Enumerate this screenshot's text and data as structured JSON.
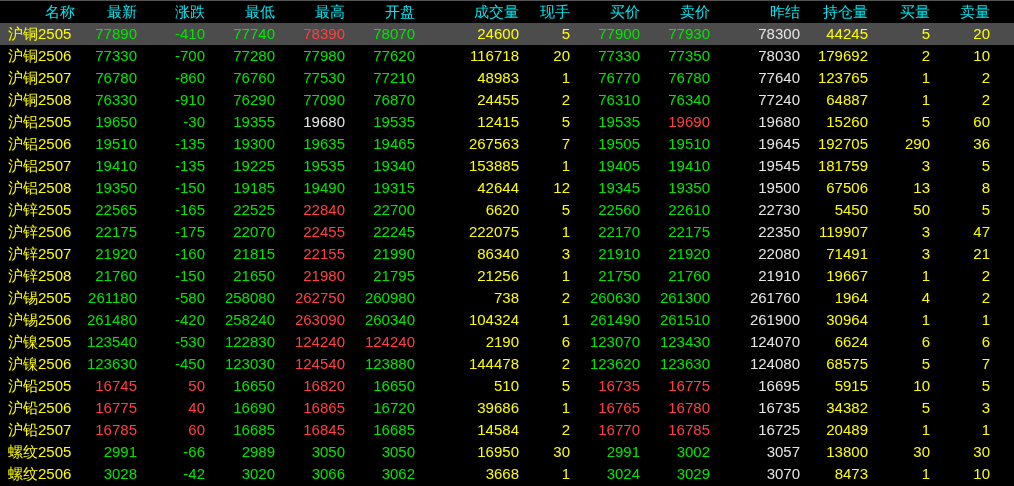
{
  "table": {
    "columns": [
      {
        "label": "名称",
        "kind": "name"
      },
      {
        "label": "最新",
        "kind": "price"
      },
      {
        "label": "涨跌",
        "kind": "change"
      },
      {
        "label": "最低",
        "kind": "price"
      },
      {
        "label": "最高",
        "kind": "price"
      },
      {
        "label": "开盘",
        "kind": "price"
      },
      {
        "label": "成交量",
        "kind": "volume"
      },
      {
        "label": "现手",
        "kind": "volume"
      },
      {
        "label": "买价",
        "kind": "price"
      },
      {
        "label": "卖价",
        "kind": "price"
      },
      {
        "label": "昨结",
        "kind": "settle"
      },
      {
        "label": "持仓量",
        "kind": "volume"
      },
      {
        "label": "买量",
        "kind": "volume"
      },
      {
        "label": "卖量",
        "kind": "volume"
      }
    ],
    "rows": [
      {
        "selected": true,
        "cells": [
          "沪铜2505",
          "77890",
          "-410",
          "77740",
          "78390",
          "78070",
          "24600",
          "5",
          "77900",
          "77930",
          "78300",
          "44245",
          "5",
          "20"
        ]
      },
      {
        "selected": false,
        "cells": [
          "沪铜2506",
          "77330",
          "-700",
          "77280",
          "77980",
          "77620",
          "116718",
          "20",
          "77330",
          "77350",
          "78030",
          "179692",
          "2",
          "10"
        ]
      },
      {
        "selected": false,
        "cells": [
          "沪铜2507",
          "76780",
          "-860",
          "76760",
          "77530",
          "77210",
          "48983",
          "1",
          "76770",
          "76780",
          "77640",
          "123765",
          "1",
          "2"
        ]
      },
      {
        "selected": false,
        "cells": [
          "沪铜2508",
          "76330",
          "-910",
          "76290",
          "77090",
          "76870",
          "24455",
          "2",
          "76310",
          "76340",
          "77240",
          "64887",
          "1",
          "2"
        ]
      },
      {
        "selected": false,
        "cells": [
          "沪铝2505",
          "19650",
          "-30",
          "19355",
          "19680",
          "19535",
          "12415",
          "5",
          "19535",
          "19690",
          "19680",
          "15260",
          "5",
          "60"
        ]
      },
      {
        "selected": false,
        "cells": [
          "沪铝2506",
          "19510",
          "-135",
          "19300",
          "19635",
          "19465",
          "267563",
          "7",
          "19505",
          "19510",
          "19645",
          "192705",
          "290",
          "36"
        ]
      },
      {
        "selected": false,
        "cells": [
          "沪铝2507",
          "19410",
          "-135",
          "19225",
          "19535",
          "19340",
          "153885",
          "1",
          "19405",
          "19410",
          "19545",
          "181759",
          "3",
          "5"
        ]
      },
      {
        "selected": false,
        "cells": [
          "沪铝2508",
          "19350",
          "-150",
          "19185",
          "19490",
          "19315",
          "42644",
          "12",
          "19345",
          "19350",
          "19500",
          "67506",
          "13",
          "8"
        ]
      },
      {
        "selected": false,
        "cells": [
          "沪锌2505",
          "22565",
          "-165",
          "22525",
          "22840",
          "22700",
          "6620",
          "5",
          "22560",
          "22610",
          "22730",
          "5450",
          "50",
          "5"
        ]
      },
      {
        "selected": false,
        "cells": [
          "沪锌2506",
          "22175",
          "-175",
          "22070",
          "22455",
          "22245",
          "222075",
          "1",
          "22170",
          "22175",
          "22350",
          "119907",
          "3",
          "47"
        ]
      },
      {
        "selected": false,
        "cells": [
          "沪锌2507",
          "21920",
          "-160",
          "21815",
          "22155",
          "21990",
          "86340",
          "3",
          "21910",
          "21920",
          "22080",
          "71491",
          "3",
          "21"
        ]
      },
      {
        "selected": false,
        "cells": [
          "沪锌2508",
          "21760",
          "-150",
          "21650",
          "21980",
          "21795",
          "21256",
          "1",
          "21750",
          "21760",
          "21910",
          "19667",
          "1",
          "2"
        ]
      },
      {
        "selected": false,
        "cells": [
          "沪锡2505",
          "261180",
          "-580",
          "258080",
          "262750",
          "260980",
          "738",
          "2",
          "260630",
          "261300",
          "261760",
          "1964",
          "4",
          "2"
        ]
      },
      {
        "selected": false,
        "cells": [
          "沪锡2506",
          "261480",
          "-420",
          "258240",
          "263090",
          "260340",
          "104324",
          "1",
          "261490",
          "261510",
          "261900",
          "30964",
          "1",
          "1"
        ]
      },
      {
        "selected": false,
        "cells": [
          "沪镍2505",
          "123540",
          "-530",
          "122830",
          "124240",
          "124240",
          "2190",
          "6",
          "123070",
          "123430",
          "124070",
          "6624",
          "6",
          "6"
        ]
      },
      {
        "selected": false,
        "cells": [
          "沪镍2506",
          "123630",
          "-450",
          "123030",
          "124540",
          "123880",
          "144478",
          "2",
          "123620",
          "123630",
          "124080",
          "68575",
          "5",
          "7"
        ]
      },
      {
        "selected": false,
        "cells": [
          "沪铅2505",
          "16745",
          "50",
          "16650",
          "16820",
          "16650",
          "510",
          "5",
          "16735",
          "16775",
          "16695",
          "5915",
          "10",
          "5"
        ]
      },
      {
        "selected": false,
        "cells": [
          "沪铅2506",
          "16775",
          "40",
          "16690",
          "16865",
          "16720",
          "39686",
          "1",
          "16765",
          "16780",
          "16735",
          "34382",
          "5",
          "3"
        ]
      },
      {
        "selected": false,
        "cells": [
          "沪铅2507",
          "16785",
          "60",
          "16685",
          "16845",
          "16685",
          "14584",
          "2",
          "16770",
          "16785",
          "16725",
          "20489",
          "1",
          "1"
        ]
      },
      {
        "selected": false,
        "cells": [
          "螺纹2505",
          "2991",
          "-66",
          "2989",
          "3050",
          "3050",
          "16950",
          "30",
          "2991",
          "3002",
          "3057",
          "13800",
          "30",
          "30"
        ]
      },
      {
        "selected": false,
        "cells": [
          "螺纹2506",
          "3028",
          "-42",
          "3020",
          "3066",
          "3062",
          "3668",
          "1",
          "3024",
          "3029",
          "3070",
          "8473",
          "1",
          "10"
        ]
      }
    ]
  }
}
